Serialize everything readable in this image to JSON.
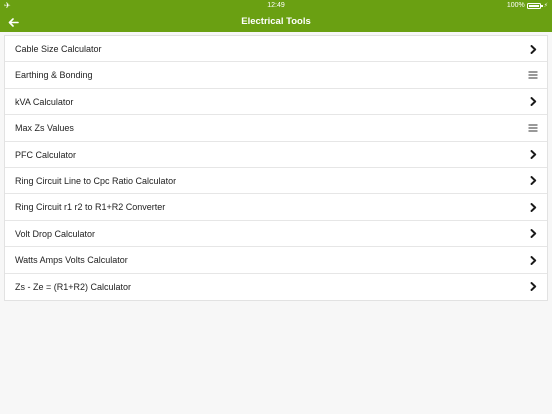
{
  "status_bar": {
    "time": "12:49",
    "battery_percent": "100%"
  },
  "nav": {
    "title": "Electrical Tools",
    "back_icon": "arrow-left-icon"
  },
  "colors": {
    "accent": "#6aa012"
  },
  "items": [
    {
      "label": "Cable Size Calculator",
      "icon": "chevron-right-icon"
    },
    {
      "label": "Earthing & Bonding",
      "icon": "menu-icon"
    },
    {
      "label": "kVA Calculator",
      "icon": "chevron-right-icon"
    },
    {
      "label": "Max Zs Values",
      "icon": "menu-icon"
    },
    {
      "label": "PFC Calculator",
      "icon": "chevron-right-icon"
    },
    {
      "label": "Ring Circuit Line to Cpc Ratio Calculator",
      "icon": "chevron-right-icon"
    },
    {
      "label": "Ring Circuit r1 r2 to R1+R2 Converter",
      "icon": "chevron-right-icon"
    },
    {
      "label": "Volt Drop Calculator",
      "icon": "chevron-right-icon"
    },
    {
      "label": "Watts Amps Volts Calculator",
      "icon": "chevron-right-icon"
    },
    {
      "label": "Zs - Ze = (R1+R2) Calculator",
      "icon": "chevron-right-icon"
    }
  ]
}
